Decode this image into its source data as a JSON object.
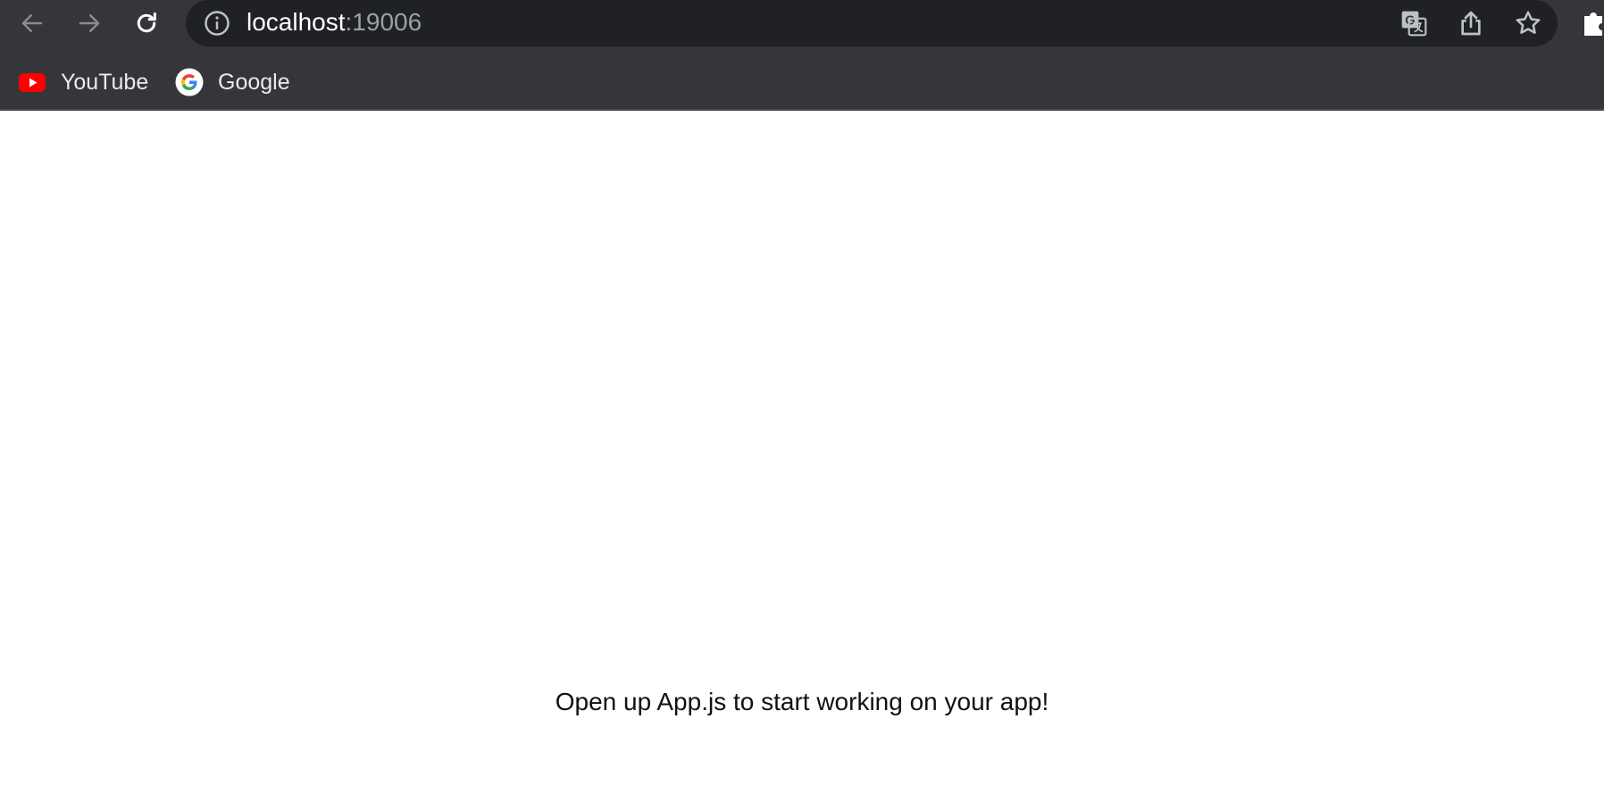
{
  "browser": {
    "back_icon": "arrow-left-icon",
    "forward_icon": "arrow-right-icon",
    "reload_icon": "reload-icon",
    "address_bar": {
      "host": "localhost",
      "port": ":19006",
      "info_icon": "info-icon"
    },
    "omnibox_actions": [
      {
        "icon": "translate-icon"
      },
      {
        "icon": "share-icon"
      },
      {
        "icon": "star-icon"
      }
    ],
    "extensions_icon": "puzzle-icon"
  },
  "bookmarks": [
    {
      "label": "YouTube",
      "icon": "youtube-icon"
    },
    {
      "label": "Google",
      "icon": "google-icon"
    }
  ],
  "page": {
    "message": "Open up App.js to start working on your app!"
  },
  "colors": {
    "toolbar_bg": "#35363a",
    "omnibox_bg": "#202124",
    "youtube_red": "#ff0000",
    "page_bg": "#ffffff"
  }
}
